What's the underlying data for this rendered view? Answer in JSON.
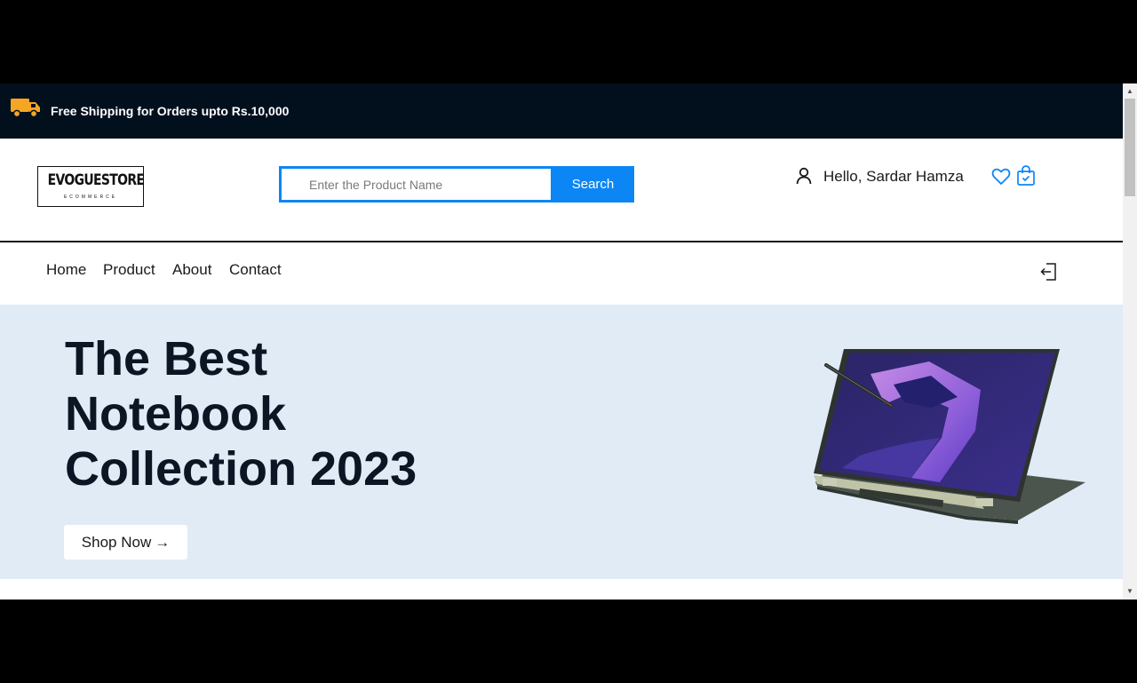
{
  "topbar": {
    "shipping_text": "Free Shipping for Orders upto Rs.10,000",
    "icon": "truck-icon",
    "background": "#02101e",
    "icon_color": "#f5a623"
  },
  "header": {
    "logo": {
      "main": "EVOGUESTORE",
      "sub": "ECOMMERCE"
    },
    "search": {
      "placeholder": "Enter the Product Name",
      "value": "",
      "button_label": "Search",
      "accent": "#0d86f5"
    },
    "greeting": "Hello, Sardar Hamza",
    "icons": [
      "user-icon",
      "heart-icon",
      "shopping-bag-icon"
    ]
  },
  "nav": {
    "items": [
      {
        "label": "Home"
      },
      {
        "label": "Product"
      },
      {
        "label": "About"
      },
      {
        "label": "Contact"
      }
    ],
    "logout_icon": "logout-icon"
  },
  "hero": {
    "title_lines": [
      "The Best",
      "Notebook",
      "Collection 2023"
    ],
    "cta_label": "Shop Now",
    "cta_arrow": "→",
    "background": "#e0ebf5",
    "image": "laptop-image"
  }
}
